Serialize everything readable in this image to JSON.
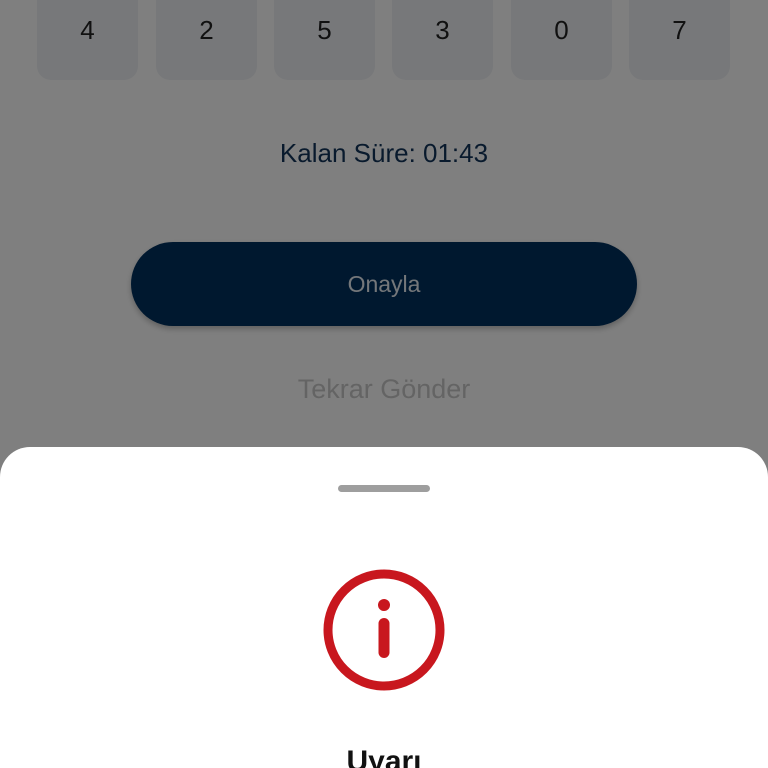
{
  "otp": {
    "digits": [
      "4",
      "2",
      "5",
      "3",
      "0",
      "7"
    ]
  },
  "timer": {
    "text": "Kalan Süre: 01:43"
  },
  "actions": {
    "confirm_label": "Onayla",
    "resend_label": "Tekrar Gönder"
  },
  "sheet": {
    "icon": "info-icon",
    "title": "Uyarı"
  },
  "colors": {
    "primary": "#00305e",
    "alert": "#c8171e",
    "scrim": "rgba(0,0,0,0.5)"
  }
}
